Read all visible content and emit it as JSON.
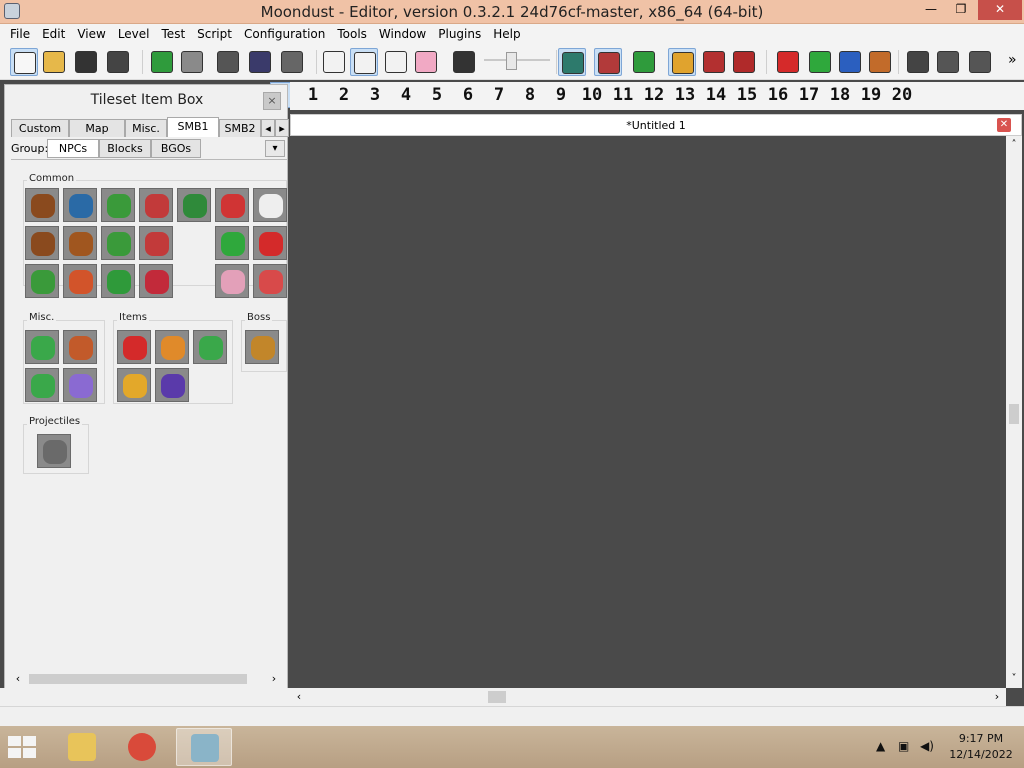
{
  "window": {
    "title": "Moondust - Editor, version 0.3.2.1 24d76cf-master, x86_64 (64-bit)",
    "min_glyph": "—",
    "max_glyph": "❐",
    "close_glyph": "✕"
  },
  "menu": [
    "File",
    "Edit",
    "View",
    "Level",
    "Test",
    "Script",
    "Configuration",
    "Tools",
    "Window",
    "Plugins",
    "Help"
  ],
  "toolbar": {
    "more_glyph": "»",
    "icons": [
      {
        "name": "new-file-icon",
        "color": "#f7f7f7"
      },
      {
        "name": "open-folder-icon",
        "color": "#e6b84a"
      },
      {
        "name": "save-icon",
        "color": "#333333"
      },
      {
        "name": "save-as-icon",
        "color": "#444444"
      },
      {
        "name": "undo-icon",
        "color": "#2f9b3c"
      },
      {
        "name": "redo-icon",
        "color": "#8a8a8a"
      },
      {
        "name": "copy-icon",
        "color": "#555555"
      },
      {
        "name": "cut-icon",
        "color": "#3a3a6a"
      },
      {
        "name": "paste-icon",
        "color": "#666666"
      },
      {
        "name": "hand-icon",
        "color": "#f2f2f2"
      },
      {
        "name": "select-icon",
        "color": "#f2f2f2"
      },
      {
        "name": "rect-select-icon",
        "color": "#f2f2f2"
      },
      {
        "name": "eraser-icon",
        "color": "#f1a9c4"
      },
      {
        "name": "resize-icon",
        "color": "#333333"
      },
      {
        "name": "film-icon",
        "color": "#2d7a6c"
      },
      {
        "name": "grid-icon",
        "color": "#b23a3a"
      },
      {
        "name": "sync-icon",
        "color": "#2f9b3c"
      },
      {
        "name": "layers-icon",
        "color": "#e0a32e"
      },
      {
        "name": "bug-icon",
        "color": "#b33030"
      },
      {
        "name": "book-icon",
        "color": "#b02a2a"
      },
      {
        "name": "flag-1-icon",
        "color": "#d52a2a"
      },
      {
        "name": "flag-2-icon",
        "color": "#2fa83c"
      },
      {
        "name": "blue-flag-icon",
        "color": "#2b5fbf"
      },
      {
        "name": "ground-icon",
        "color": "#c26b2a"
      },
      {
        "name": "section-icon",
        "color": "#444444"
      },
      {
        "name": "lock-icon",
        "color": "#555555"
      },
      {
        "name": "lock-alt-icon",
        "color": "#555555"
      }
    ]
  },
  "layers": {
    "first": "0",
    "numbers": [
      "1",
      "2",
      "3",
      "4",
      "5",
      "6",
      "7",
      "8",
      "9",
      "10",
      "11",
      "12",
      "13",
      "14",
      "15",
      "16",
      "17",
      "18",
      "19",
      "20"
    ]
  },
  "tileset": {
    "title": "Tileset Item Box",
    "close_glyph": "×",
    "tabs": [
      "Custom",
      "Map",
      "Misc.",
      "SMB1",
      "SMB2"
    ],
    "active_tab": "SMB1",
    "nav_left": "◂",
    "nav_right": "▸",
    "group_label": "Group:",
    "group_tabs": [
      "NPCs",
      "Blocks",
      "BGOs"
    ],
    "dropdown_glyph": "▾",
    "sections": {
      "common": "Common",
      "misc": "Misc.",
      "items": "Items",
      "boss": "Boss",
      "projectiles": "Projectiles"
    },
    "common_tiles": [
      {
        "name": "goomba-icon",
        "color": "#8a4a1e"
      },
      {
        "name": "blue-goomba-icon",
        "color": "#2a6aa6"
      },
      {
        "name": "green-koopa-icon",
        "color": "#3a9a3a"
      },
      {
        "name": "red-koopa-icon",
        "color": "#c23a3a"
      },
      {
        "name": "piranha-plant-icon",
        "color": "#2f8a3a"
      },
      {
        "name": "red-dino-icon",
        "color": "#d03434"
      },
      {
        "name": "boo-icon",
        "color": "#eeeeee"
      },
      {
        "name": "goomba-2-icon",
        "color": "#8a4a1e"
      },
      {
        "name": "goomba-3-icon",
        "color": "#a0561f"
      },
      {
        "name": "green-paratroopa-icon",
        "color": "#3a9a3a"
      },
      {
        "name": "red-paratroopa-icon",
        "color": "#c23a3a"
      },
      {
        "name": "green-dino-icon",
        "color": "#2fa83c"
      },
      {
        "name": "red-gem-icon",
        "color": "#d42a2a"
      },
      {
        "name": "hammer-bro-icon",
        "color": "#3a9a3a"
      },
      {
        "name": "fireball-icon",
        "color": "#d2542a"
      },
      {
        "name": "green-shell-icon",
        "color": "#2f9a3a"
      },
      {
        "name": "red-shell-icon",
        "color": "#c22a3a"
      },
      {
        "name": "squid-icon",
        "color": "#e3a0b9"
      },
      {
        "name": "spiny-icon",
        "color": "#d84a4a"
      }
    ],
    "misc_tiles": [
      {
        "name": "vine-icon",
        "color": "#3aa84a"
      },
      {
        "name": "rope-icon",
        "color": "#c25a2a"
      },
      {
        "name": "vine-2-icon",
        "color": "#3aa84a"
      },
      {
        "name": "purple-door-icon",
        "color": "#8a6ad2"
      }
    ],
    "item_tiles": [
      {
        "name": "super-mushroom-icon",
        "color": "#d42a2a"
      },
      {
        "name": "fire-flower-icon",
        "color": "#e08a2a"
      },
      {
        "name": "1up-mushroom-icon",
        "color": "#3aa84a"
      },
      {
        "name": "coin-icon",
        "color": "#e3a82a"
      },
      {
        "name": "poison-mushroom-icon",
        "color": "#5a3aaa"
      }
    ],
    "boss_tiles": [
      {
        "name": "bowser-icon",
        "color": "#c2862a"
      }
    ],
    "projectile_tiles": [
      {
        "name": "hammer-icon",
        "color": "#6a6a6a"
      }
    ],
    "scroll_left": "‹",
    "scroll_right": "›"
  },
  "document": {
    "title": "*Untitled 1",
    "close_glyph": "✕",
    "up_glyph": "˄",
    "down_glyph": "˅",
    "left_glyph": "‹",
    "right_glyph": "›",
    "canvas_color": "#4a4a4a"
  },
  "taskbar": {
    "apps": [
      {
        "name": "file-explorer-icon",
        "color": "#e8c45a"
      },
      {
        "name": "chrome-icon",
        "color": "#d94a3a"
      },
      {
        "name": "moondust-icon",
        "color": "#8ab4c8"
      }
    ],
    "tray": {
      "up_glyph": "▲",
      "network_glyph": "▣",
      "volume_glyph": "◀)"
    },
    "time": "9:17 PM",
    "date": "12/14/2022"
  }
}
